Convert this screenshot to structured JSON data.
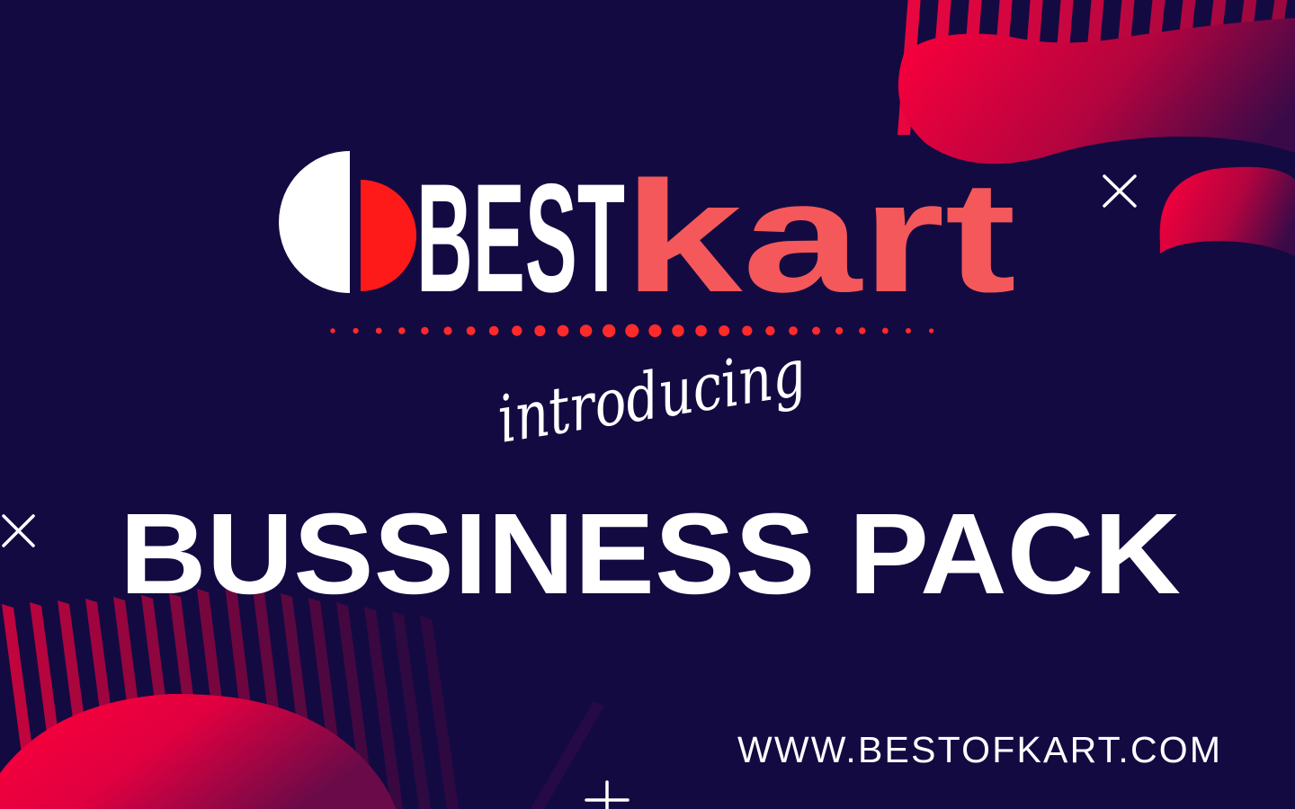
{
  "logo": {
    "brand_part1": "BEST",
    "brand_part2": "kart"
  },
  "tagline": "introducing",
  "headline": "BUSSINESS PACK",
  "website": "WWW.BESTOFKART.COM",
  "colors": {
    "background": "#140a42",
    "accent_red": "#ff1a1a",
    "kart_coral": "#f4585a",
    "blob_red": "#f5003c",
    "blob_dark": "#5a0a4a",
    "text_white": "#ffffff"
  },
  "icons": [
    "cross-icon",
    "cross-icon",
    "plus-icon"
  ]
}
